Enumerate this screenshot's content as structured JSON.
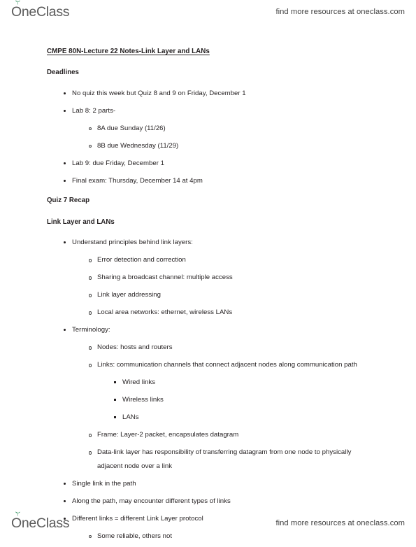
{
  "branding": {
    "logo_first": "O",
    "logo_rest": "neClass",
    "logo_icon": "sprout-leaf-icon",
    "tagline": "find more resources at oneclass.com",
    "logo_color": "#5b5b5b",
    "sprout_color": "#2f8f5b"
  },
  "document": {
    "title": "CMPE 80N-Lecture 22 Notes-Link Layer and LANs",
    "sections": [
      {
        "heading": "Deadlines",
        "items": [
          {
            "level": 1,
            "text": "No quiz this week but Quiz 8 and 9 on Friday, December 1"
          },
          {
            "level": 1,
            "text": "Lab 8: 2 parts-",
            "children": [
              {
                "level": 2,
                "text": "8A due Sunday (11/26)"
              },
              {
                "level": 2,
                "text": "8B due Wednesday (11/29)"
              }
            ]
          },
          {
            "level": 1,
            "text": "Lab 9: due Friday, December 1"
          },
          {
            "level": 1,
            "text": "Final exam: Thursday, December 14 at 4pm"
          }
        ]
      },
      {
        "heading": "Quiz 7 Recap",
        "items": []
      },
      {
        "heading": "Link Layer and LANs",
        "items": [
          {
            "level": 1,
            "text": "Understand principles behind link layers:",
            "children": [
              {
                "level": 2,
                "text": "Error detection and correction"
              },
              {
                "level": 2,
                "text": "Sharing a broadcast channel: multiple access"
              },
              {
                "level": 2,
                "text": "Link layer addressing"
              },
              {
                "level": 2,
                "text": "Local area networks: ethernet, wireless LANs"
              }
            ]
          },
          {
            "level": 1,
            "text": "Terminology:",
            "children": [
              {
                "level": 2,
                "text": "Nodes: hosts and routers"
              },
              {
                "level": 2,
                "text": "Links: communication channels that connect adjacent nodes along communication path",
                "children": [
                  {
                    "level": 3,
                    "text": "Wired links"
                  },
                  {
                    "level": 3,
                    "text": "Wireless links"
                  },
                  {
                    "level": 3,
                    "text": "LANs"
                  }
                ]
              },
              {
                "level": 2,
                "text": "Frame: Layer-2 packet, encapsulates datagram"
              },
              {
                "level": 2,
                "text": "Data-link layer has responsibility of transferring datagram from one node to physically adjacent node over a link"
              }
            ]
          },
          {
            "level": 1,
            "text": "Single link in the path"
          },
          {
            "level": 1,
            "text": "Along the path, may encounter different types of links"
          },
          {
            "level": 1,
            "text": "Different links = different Link Layer protocol",
            "children": [
              {
                "level": 2,
                "text": "Some reliable, others not"
              }
            ]
          }
        ]
      }
    ]
  }
}
